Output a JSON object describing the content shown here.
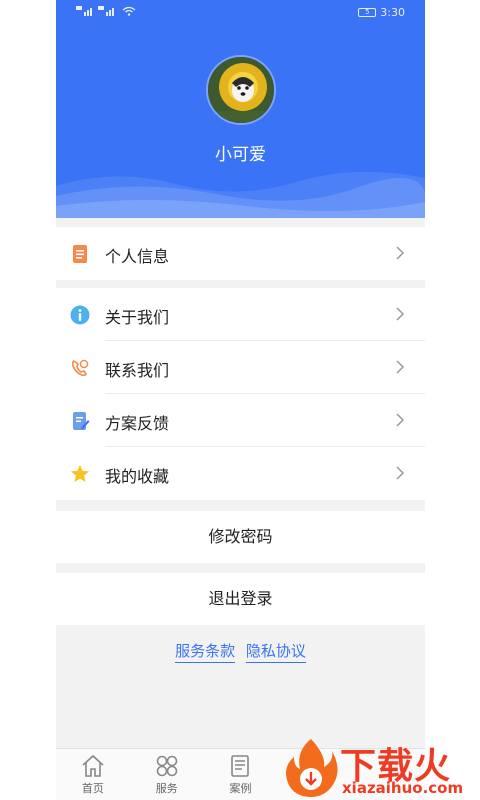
{
  "status_bar": {
    "time": "3:30",
    "battery": "5"
  },
  "profile": {
    "username": "小可爱"
  },
  "menu": {
    "personal_info": "个人信息",
    "items": [
      {
        "label": "关于我们",
        "icon": "info-icon"
      },
      {
        "label": "联系我们",
        "icon": "phone-icon"
      },
      {
        "label": "方案反馈",
        "icon": "feedback-icon"
      },
      {
        "label": "我的收藏",
        "icon": "star-icon"
      }
    ]
  },
  "actions": {
    "change_password": "修改密码",
    "logout": "退出登录"
  },
  "footer_links": {
    "terms": "服务条款",
    "privacy": "隐私协议"
  },
  "tabs": [
    {
      "label": "首页",
      "icon": "home-icon"
    },
    {
      "label": "服务",
      "icon": "grid-icon"
    },
    {
      "label": "案例",
      "icon": "case-icon"
    }
  ],
  "watermark": {
    "brand": "下载火",
    "site": "xiazaihuo.com"
  },
  "colors": {
    "primary": "#3a73f5",
    "background": "#f2f2f2",
    "accent_orange": "#f5894a",
    "star": "#f7c325"
  }
}
